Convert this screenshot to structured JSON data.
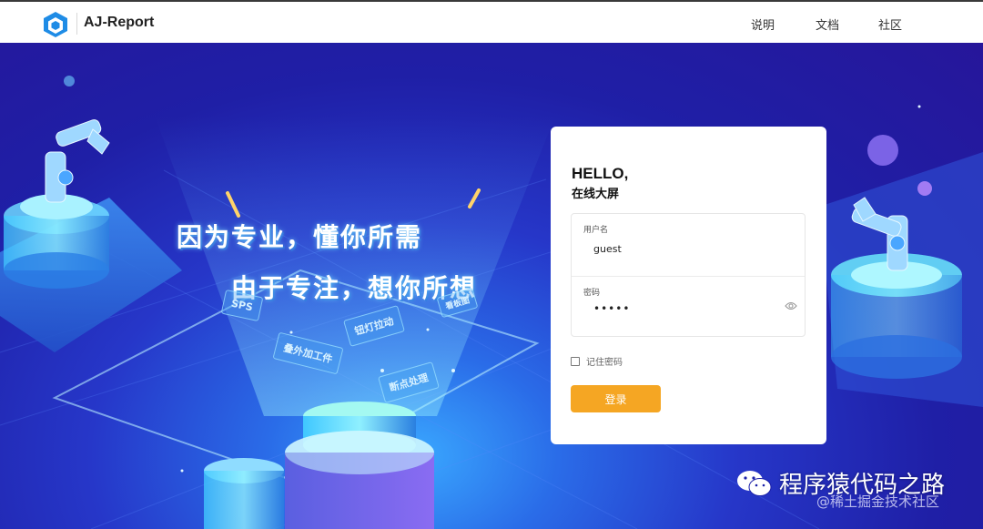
{
  "header": {
    "brand": "AJ-Report",
    "nav": [
      {
        "label": "说明"
      },
      {
        "label": "文档"
      },
      {
        "label": "社区"
      }
    ]
  },
  "hero": {
    "slogan_line1": "因为专业，懂你所需",
    "slogan_line2": "由于专注，想你所想",
    "tags": [
      "SPS",
      "叠外加工件",
      "钮灯拉动",
      "断点处理",
      "看板图"
    ]
  },
  "login": {
    "greeting": "HELLO,",
    "subtitle": "在线大屏",
    "username_label": "用户名",
    "username_value": "guest",
    "password_label": "密码",
    "password_value": "•••••",
    "remember_label": "记住密码",
    "remember_checked": false,
    "submit_label": "登录",
    "accent_color": "#f5a623"
  },
  "watermark": {
    "primary": "程序猿代码之路",
    "secondary": "@稀土掘金技术社区"
  },
  "icons": {
    "logo": "cube-logo-icon",
    "password_toggle": "eye-icon",
    "watermark": "wechat-icon"
  }
}
